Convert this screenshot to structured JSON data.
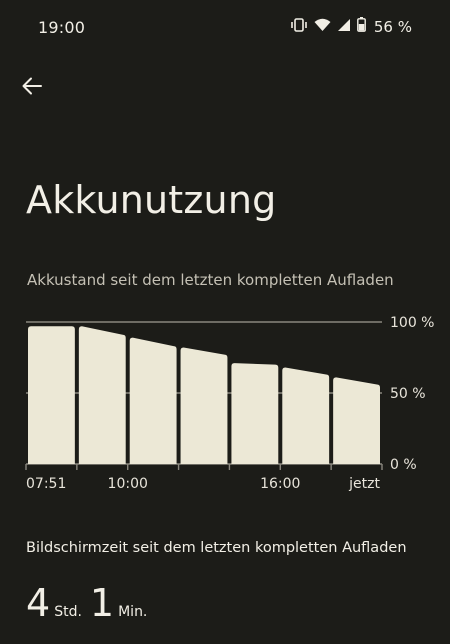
{
  "status_bar": {
    "time": "19:00",
    "battery_percent": "56 %",
    "icons": [
      "vibrate-icon",
      "wifi-icon",
      "signal-icon",
      "battery-icon"
    ]
  },
  "header": {
    "back_icon": "back-arrow-icon",
    "title": "Akkunutzung"
  },
  "chart_section": {
    "subtitle": "Akkustand seit dem letzten kompletten Aufladen"
  },
  "chart_data": {
    "type": "bar",
    "y_tick_labels": [
      "100 %",
      "50 %",
      "0 %"
    ],
    "ylim": [
      0,
      100
    ],
    "x_tick_labels": [
      "07:51",
      "10:00",
      "16:00",
      "jetzt"
    ],
    "bars": [
      {
        "start": 97,
        "end": 97
      },
      {
        "start": 97,
        "end": 91
      },
      {
        "start": 89,
        "end": 83
      },
      {
        "start": 82,
        "end": 77
      },
      {
        "start": 71,
        "end": 70
      },
      {
        "start": 68,
        "end": 63
      },
      {
        "start": 61,
        "end": 56
      }
    ],
    "bar_color": "#ece8d6",
    "grid_color": "#8a877e"
  },
  "screen_time": {
    "label": "Bildschirmzeit seit dem letzten kompletten Aufladen",
    "hours_value": "4",
    "hours_unit": "Std.",
    "minutes_value": "1",
    "minutes_unit": "Min."
  }
}
